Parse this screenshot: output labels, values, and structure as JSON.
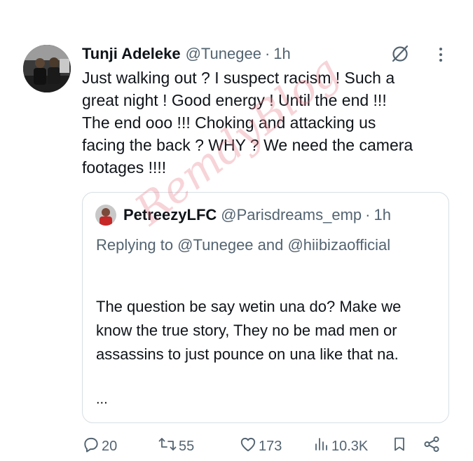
{
  "tweet": {
    "author": {
      "display_name": "Tunji Adeleke",
      "handle": "@Tunegee",
      "separator": "·",
      "time": "1h"
    },
    "text": "Just walking out ? I suspect racism ! Such a\ngreat night ! Good energy ! Until the end !!!\nThe end ooo !!! Choking and attacking us\nfacing the back ? WHY ? We need the camera\nfootages !!!!",
    "icons": {
      "grok": "grok-icon",
      "more": "more-options-icon"
    }
  },
  "quote": {
    "author": {
      "display_name": "PetreezyLFC",
      "handle": "@Parisdreams_emp",
      "separator": "·",
      "time": "1h"
    },
    "replying_to": "Replying to @Tunegee and @hiibizaofficial",
    "text": "The question be say wetin una do? Make we know the true story, They no be mad men or assassins to just pounce on una like that na.",
    "ellipsis": "..."
  },
  "actions": {
    "replies": "20",
    "reposts": "55",
    "likes": "173",
    "views": "10.3K"
  },
  "watermark": "RemdyBlog",
  "colors": {
    "text": "#0f1419",
    "secondary": "#536471",
    "border": "#d6dee3",
    "watermark": "#e67887"
  }
}
